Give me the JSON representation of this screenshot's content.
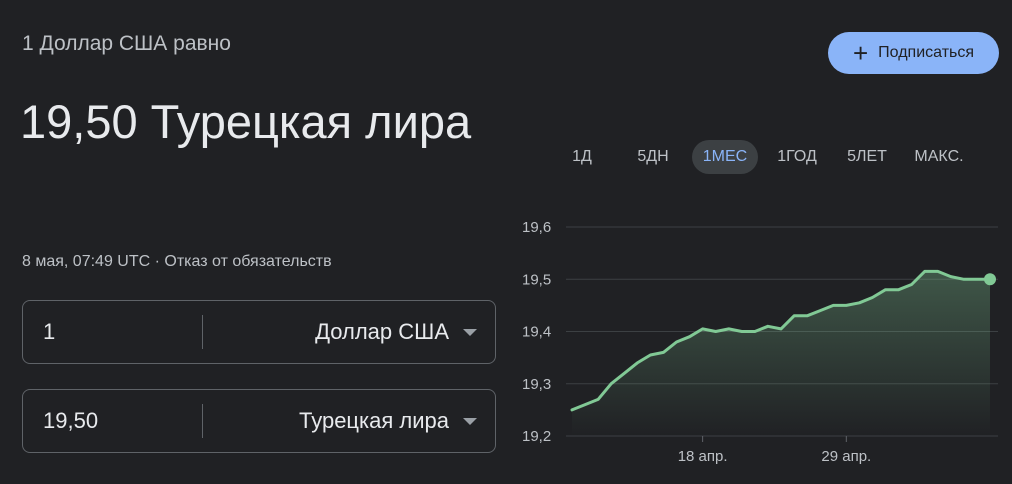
{
  "header": {
    "subtitle": "1 Доллар США равно",
    "big_value": "19,50 Турецкая лира",
    "timestamp": "8 мая, 07:49 UTC",
    "separator": " · ",
    "disclaimer": "Отказ от обязательств"
  },
  "subscribe": {
    "icon": "plus-icon",
    "label": "Подписаться"
  },
  "converter": [
    {
      "amount": "1",
      "currency": "Доллар США"
    },
    {
      "amount": "19,50",
      "currency": "Турецкая лира"
    }
  ],
  "ranges": [
    {
      "label": "1Д",
      "active": false
    },
    {
      "label": "5ДН",
      "active": false
    },
    {
      "label": "1МЕС",
      "active": true
    },
    {
      "label": "1ГОД",
      "active": false
    },
    {
      "label": "5ЛЕТ",
      "active": false
    },
    {
      "label": "МАКС.",
      "active": false
    }
  ],
  "colors": {
    "line": "#81c995",
    "accent": "#8ab4f8",
    "background": "#202124"
  },
  "chart_data": {
    "type": "line",
    "ylim": [
      19.2,
      19.6
    ],
    "yticks": [
      19.6,
      19.5,
      19.4,
      19.3,
      19.2
    ],
    "ytick_labels": [
      "19,6",
      "19,5",
      "19,4",
      "19,3",
      "19,2"
    ],
    "xticks": [
      {
        "label": "18 апр.",
        "x": 10
      },
      {
        "label": "29 апр.",
        "x": 21
      }
    ],
    "xlim": [
      0,
      32
    ],
    "x": [
      0,
      1,
      2,
      3,
      4,
      5,
      6,
      7,
      8,
      9,
      10,
      11,
      12,
      13,
      14,
      15,
      16,
      17,
      18,
      19,
      20,
      21,
      22,
      23,
      24,
      25,
      26,
      27,
      28,
      29,
      30,
      31,
      32
    ],
    "y": [
      19.25,
      19.26,
      19.27,
      19.3,
      19.32,
      19.34,
      19.355,
      19.36,
      19.38,
      19.39,
      19.405,
      19.4,
      19.405,
      19.4,
      19.4,
      19.41,
      19.405,
      19.43,
      19.43,
      19.44,
      19.45,
      19.45,
      19.455,
      19.465,
      19.48,
      19.48,
      19.49,
      19.515,
      19.515,
      19.505,
      19.5,
      19.5,
      19.5
    ]
  }
}
